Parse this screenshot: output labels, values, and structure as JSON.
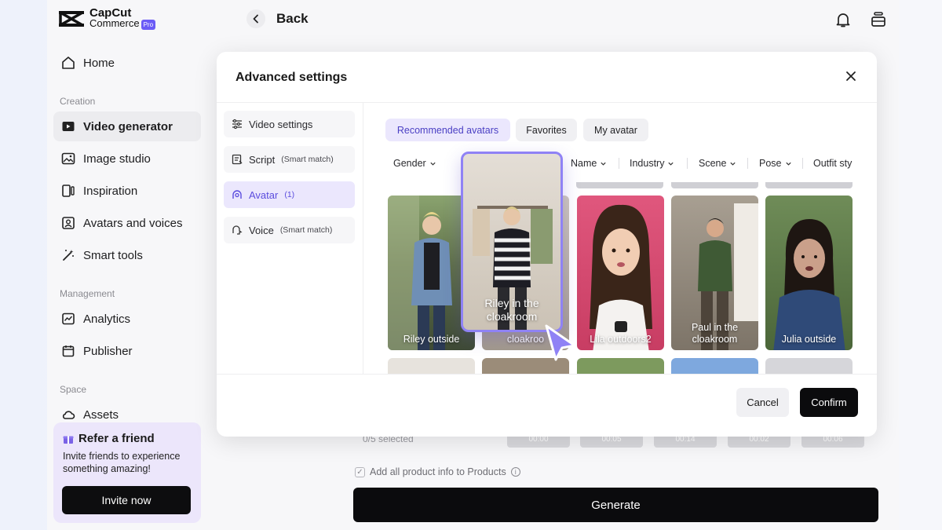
{
  "brand": {
    "line1": "CapCut",
    "line2": "Commerce",
    "badge": "Pro"
  },
  "sidebar": {
    "home": "Home",
    "sections": {
      "creation": "Creation",
      "management": "Management",
      "space": "Space"
    },
    "items": [
      {
        "label": "Video generator",
        "active": true
      },
      {
        "label": "Image studio"
      },
      {
        "label": "Inspiration"
      },
      {
        "label": "Avatars and voices"
      },
      {
        "label": "Smart tools"
      }
    ],
    "management_items": [
      {
        "label": "Analytics"
      },
      {
        "label": "Publisher"
      }
    ],
    "space_items": [
      {
        "label": "Assets"
      }
    ],
    "refer": {
      "title": "Refer a friend",
      "desc": "Invite friends to experience something amazing!",
      "button": "Invite now"
    }
  },
  "topbar": {
    "back_label": "Back"
  },
  "background": {
    "selected": "0/5 selected",
    "chips": [
      "00:00",
      "00:05",
      "00:14",
      "00:02",
      "00:06"
    ],
    "add_info": "Add all product info to Products",
    "generate": "Generate"
  },
  "modal": {
    "title": "Advanced settings",
    "tabs": [
      {
        "label": "Video settings",
        "sub": ""
      },
      {
        "label": "Script",
        "sub": "(Smart match)"
      },
      {
        "label": "Avatar",
        "sub": "(1)",
        "active": true
      },
      {
        "label": "Voice",
        "sub": "(Smart match)"
      }
    ],
    "pills": [
      "Recommended avatars",
      "Favorites",
      "My avatar"
    ],
    "filters": [
      "Gender",
      "Name",
      "Industry",
      "Scene",
      "Pose",
      "Outfit sty"
    ],
    "avatars": [
      {
        "label": "Riley outside",
        "bg": "#6d7a55"
      },
      {
        "label": "cloakroo",
        "bg": "#bdb5a8"
      },
      {
        "label": "Lila outdoors2",
        "bg": "#d8476e"
      },
      {
        "label": "Paul in the cloakroom",
        "bg": "#8a7f70"
      },
      {
        "label": "Julia outside",
        "bg": "#4f6b45"
      }
    ],
    "dragging": {
      "label": "Riley in the cloakroom"
    },
    "cancel": "Cancel",
    "confirm": "Confirm"
  },
  "colors": {
    "accent": "#8f82f5",
    "accent_bg": "#ebe7fd",
    "primary": "#0b0b0d"
  }
}
